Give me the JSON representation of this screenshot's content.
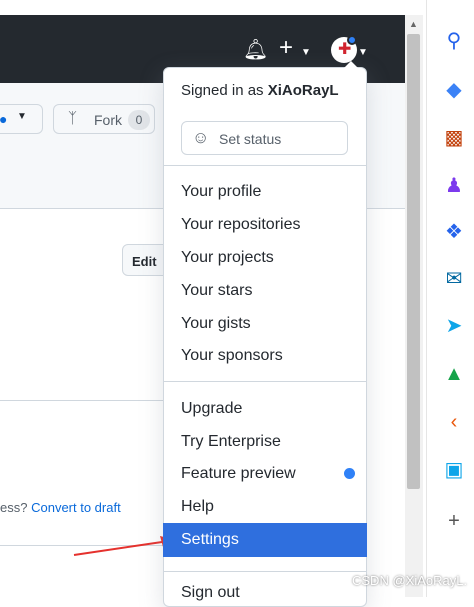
{
  "header": {
    "bell_icon": "bell-icon",
    "plus_icon": "plus-icon",
    "avatar_icon": "avatar"
  },
  "repo": {
    "fork_label": "Fork",
    "fork_count": "0",
    "edit_label": "Edit",
    "still_prefix": "ess?",
    "convert_draft": "Convert to draft"
  },
  "menu": {
    "signed_in_prefix": "Signed in as",
    "username": "XiAoRayL",
    "set_status": "Set status",
    "group1": [
      "Your profile",
      "Your repositories",
      "Your projects",
      "Your stars",
      "Your gists",
      "Your sponsors"
    ],
    "group2": [
      "Upgrade",
      "Try Enterprise",
      "Feature preview",
      "Help",
      "Settings"
    ],
    "sign_out": "Sign out"
  },
  "watermark": "CSDN @XiAoRayL.",
  "colors": {
    "header_bg": "#24292f",
    "selected_bg": "#2f6fde",
    "accent_dot": "#2f81f7",
    "arrow": "#e5312d"
  }
}
